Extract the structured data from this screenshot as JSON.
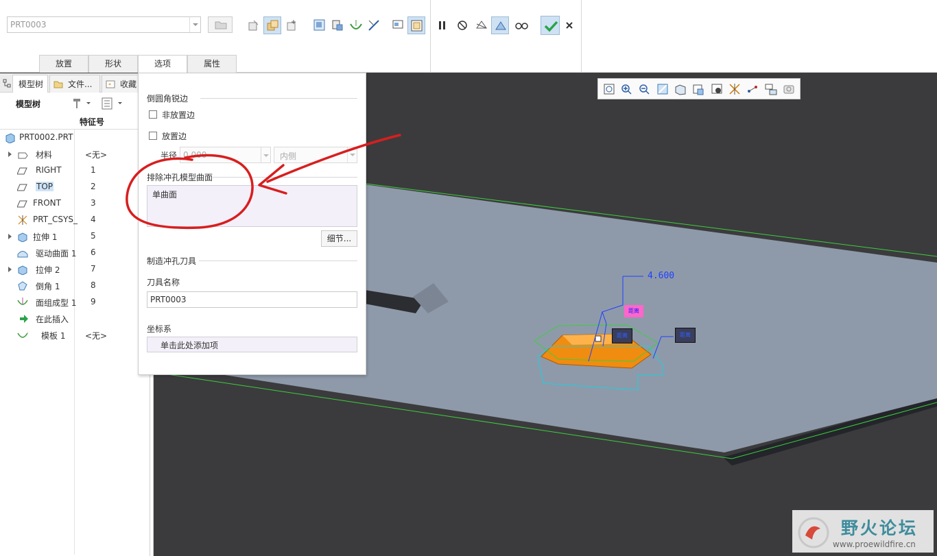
{
  "ribbon": {
    "part_combo_value": "PRT0003",
    "tabs": [
      "放置",
      "形状",
      "选项",
      "属性"
    ],
    "active_tab": "选项"
  },
  "left_panel": {
    "tabs": [
      "模型树",
      "文件...",
      "收藏"
    ],
    "tree_title": "模型树",
    "column_header": "特征号",
    "root": "PRT0002.PRT",
    "items": [
      {
        "name": "材料",
        "num": "<无>",
        "icon": "material-icon",
        "expandable": true
      },
      {
        "name": "RIGHT",
        "num": "1",
        "icon": "datum-plane-icon",
        "expandable": false
      },
      {
        "name": "TOP",
        "num": "2",
        "icon": "datum-plane-icon",
        "expandable": false,
        "selected": true
      },
      {
        "name": "FRONT",
        "num": "3",
        "icon": "datum-plane-icon",
        "expandable": false
      },
      {
        "name": "PRT_CSYS_",
        "num": "4",
        "icon": "csys-icon",
        "expandable": false
      },
      {
        "name": "拉伸 1",
        "num": "5",
        "icon": "extrude-icon",
        "expandable": true
      },
      {
        "name": "驱动曲面 1",
        "num": "6",
        "icon": "surface-icon",
        "expandable": false
      },
      {
        "name": "拉伸 2",
        "num": "7",
        "icon": "extrude-icon",
        "expandable": true
      },
      {
        "name": "倒角 1",
        "num": "8",
        "icon": "chamfer-icon",
        "expandable": false
      },
      {
        "name": "面组成型 1",
        "num": "9",
        "icon": "form-icon",
        "expandable": false
      },
      {
        "name": "在此插入",
        "num": "",
        "icon": "insert-arrow-icon",
        "expandable": false
      },
      {
        "name": "模板 1",
        "num": "<无>",
        "icon": "template-icon",
        "expandable": false
      }
    ]
  },
  "options": {
    "sharp_edges_heading": "倒圆角锐边",
    "non_placement_edges": "非放置边",
    "placement_edges": "放置边",
    "radius_label": "半径",
    "radius_value": "0.000",
    "side_value": "内侧",
    "exclude_heading": "排除冲孔模型曲面",
    "exclude_item": "单曲面",
    "details_button": "细节...",
    "punch_tool_heading": "制造冲孔刀具",
    "tool_name_label": "刀具名称",
    "tool_name_value": "PRT0003",
    "csys_label": "坐标系",
    "csys_placeholder": "单击此处添加项"
  },
  "viewport": {
    "dimension_value": "4.600",
    "tag_pink": "距离",
    "tag_dark_1": "距离",
    "tag_dark_2": "距离"
  },
  "watermark": {
    "title": "野火论坛",
    "url": "www.proewildfire.cn"
  },
  "colors": {
    "viewport_bg": "#3b3b3d",
    "sheet_fill": "#8e9aaa",
    "highlight_orange": "#f08c10",
    "confirm_green": "#2aa44a",
    "annotation_red": "#d81e1e"
  }
}
